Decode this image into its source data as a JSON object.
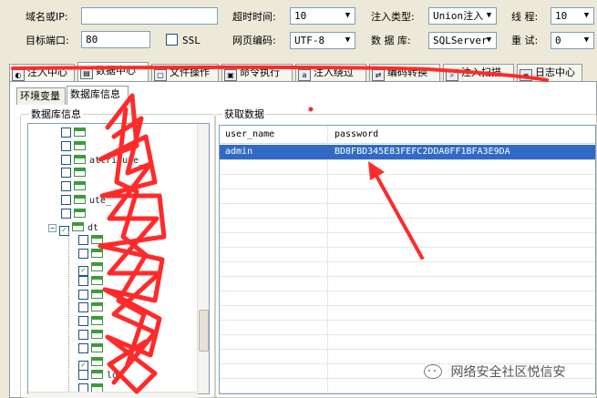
{
  "form": {
    "domain_label": "域名或IP:",
    "domain_value": "",
    "target_port_label": "目标端口:",
    "target_port_value": "80",
    "ssl_label": "SSL",
    "timeout_label": "超时时间:",
    "timeout_value": "10",
    "encoding_label": "网页编码:",
    "encoding_value": "UTF-8",
    "inject_type_label": "注入类型:",
    "inject_type_value": "Union注入",
    "database_label": "数 据 库:",
    "database_value": "SQLServer",
    "threads_label": "线 程:",
    "threads_value": "10",
    "retry_label": "重 试:",
    "retry_value": "0"
  },
  "tabs": [
    {
      "label": "注入中心",
      "icon": "globe-icon"
    },
    {
      "label": "数据中心",
      "icon": "database-icon"
    },
    {
      "label": "文件操作",
      "icon": "file-icon"
    },
    {
      "label": "命令执行",
      "icon": "terminal-icon"
    },
    {
      "label": "注入绕过",
      "icon": "bypass-icon"
    },
    {
      "label": "编码转换",
      "icon": "encode-icon"
    },
    {
      "label": "注入扫描",
      "icon": "scan-icon"
    },
    {
      "label": "日志中心",
      "icon": "log-icon"
    }
  ],
  "subtabs": [
    {
      "label": "环境变量"
    },
    {
      "label": "数据库信息"
    }
  ],
  "db_info": {
    "title": "数据库信息",
    "tree": [
      {
        "text": "",
        "checked": false
      },
      {
        "text": "",
        "checked": false
      },
      {
        "text": "attribute_",
        "checked": false
      },
      {
        "text": "",
        "checked": false
      },
      {
        "text": "",
        "checked": false
      },
      {
        "text": "ute_",
        "checked": false
      },
      {
        "text": "",
        "checked": false
      },
      {
        "text": "dt",
        "checked": true
      },
      {
        "text": "",
        "checked": false
      },
      {
        "text": "",
        "checked": false
      },
      {
        "text": "",
        "checked": true
      },
      {
        "text": "",
        "checked": false
      },
      {
        "text": "",
        "checked": false
      },
      {
        "text": "",
        "checked": false
      },
      {
        "text": "",
        "checked": false
      },
      {
        "text": "",
        "checked": false
      },
      {
        "text": "",
        "checked": false
      },
      {
        "text": "",
        "checked": true
      },
      {
        "text": "lo",
        "checked": false
      },
      {
        "text": "",
        "checked": false
      }
    ]
  },
  "results": {
    "title": "获取数据",
    "columns": [
      "user_name",
      "password"
    ],
    "rows": [
      [
        "admin",
        "BD8FBD345E83FEFC2DDA0FF1BFA3E9DA"
      ]
    ]
  },
  "watermark": "网络安全社区悦信安",
  "colors": {
    "annotation": "#ff2a2a",
    "selection": "#316ac5"
  }
}
